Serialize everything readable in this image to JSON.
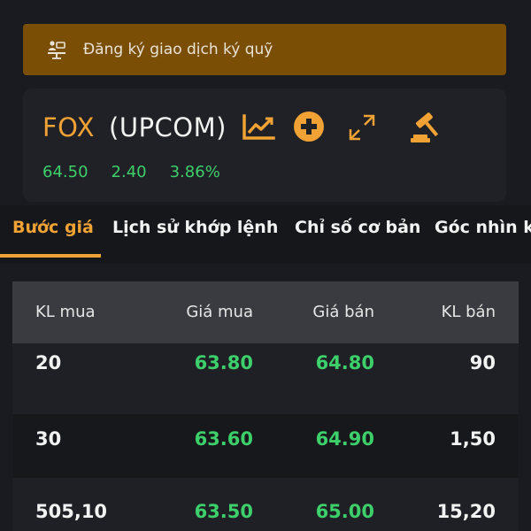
{
  "banner": {
    "icon": "margin-trading-icon",
    "text": "Đăng ký giao dịch ký quỹ"
  },
  "stock": {
    "ticker": "FOX",
    "exchange": "(UPCOM)",
    "price": "64.50",
    "change": "2.40",
    "change_pct": "3.86%",
    "icons": [
      "chart-icon",
      "add-watchlist-icon",
      "expand-icon",
      "auction-icon"
    ]
  },
  "tabs": [
    {
      "label": "Bước giá",
      "active": true
    },
    {
      "label": "Lịch sử khớp lệnh",
      "active": false
    },
    {
      "label": "Chỉ số cơ bản",
      "active": false
    },
    {
      "label": "Góc nhìn kỹ",
      "active": false
    }
  ],
  "order_book": {
    "headers": [
      "KL mua",
      "Giá mua",
      "Giá bán",
      "KL bán"
    ],
    "rows": [
      {
        "buy_vol": "20",
        "buy_price": "63.80",
        "sell_price": "64.80",
        "sell_vol": "90"
      },
      {
        "buy_vol": "30",
        "buy_price": "63.60",
        "sell_price": "64.90",
        "sell_vol": "1,50"
      },
      {
        "buy_vol": "505,10",
        "buy_price": "63.50",
        "sell_price": "65.00",
        "sell_vol": "15,20"
      }
    ]
  },
  "colors": {
    "accent": "#f0a234",
    "positive": "#3ccf6a",
    "banner_bg": "#7a4f05"
  }
}
